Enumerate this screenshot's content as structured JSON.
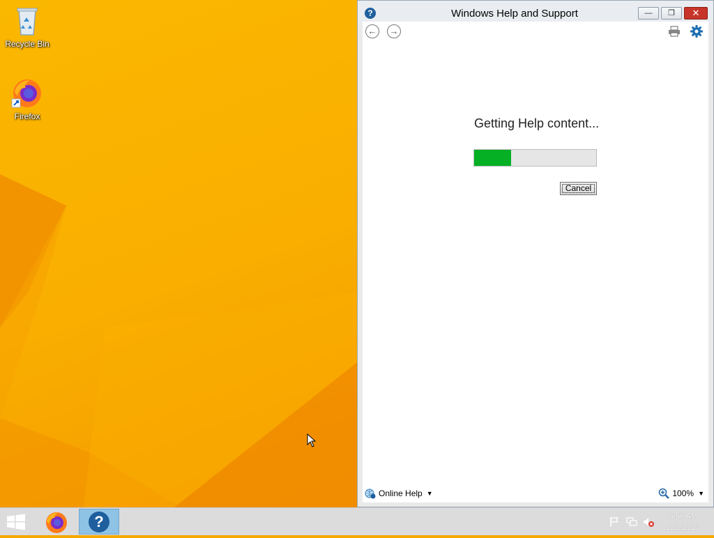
{
  "desktop": {
    "icons": [
      {
        "label": "Recycle Bin",
        "icon": "recycle-bin-icon"
      },
      {
        "label": "Firefox",
        "icon": "firefox-icon"
      }
    ]
  },
  "window": {
    "title": "Windows Help and Support",
    "controls": {
      "minimize": "minimize-icon",
      "maximize": "maximize-icon",
      "close": "close-icon"
    },
    "toolbar": {
      "back": "back-arrow-icon",
      "forward": "forward-arrow-icon",
      "print": "print-icon",
      "settings": "gear-icon"
    },
    "content": {
      "loading_text": "Getting Help content...",
      "progress": 0.3,
      "cancel_label": "Cancel"
    },
    "status": {
      "online_help_label": "Online Help",
      "zoom_label": "100%"
    }
  },
  "taskbar": {
    "apps": [
      {
        "icon": "firefox-icon",
        "active": false
      },
      {
        "icon": "help-icon",
        "active": true
      }
    ],
    "tray": [
      "flag-icon",
      "network-icon",
      "volume-muted-icon"
    ],
    "clock": {
      "time": "5:56 AM",
      "date": "12/2/2023"
    }
  },
  "colors": {
    "wallpaper": "#f9ae00",
    "progress_fill": "#06b025",
    "taskbar": "#dcdcdc",
    "help_active": "#8fc3e6"
  }
}
